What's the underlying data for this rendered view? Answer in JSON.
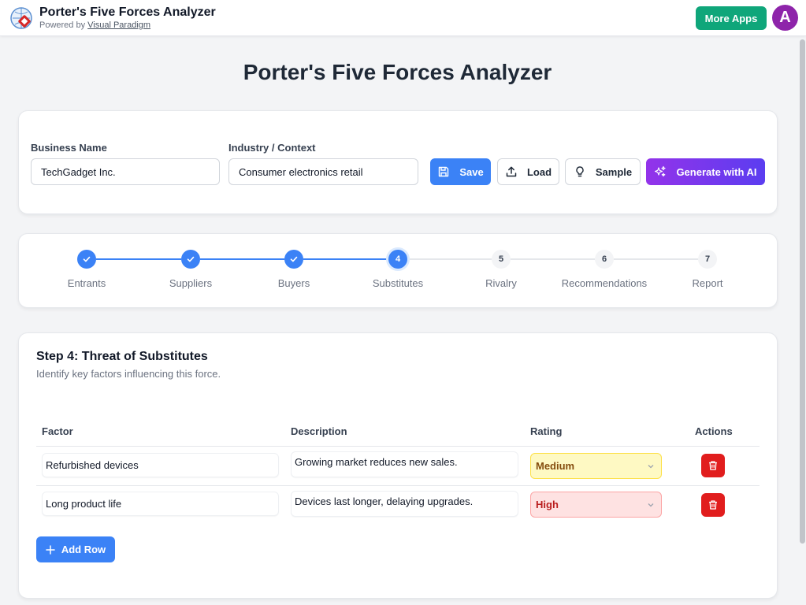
{
  "header": {
    "app_title": "Porter's Five Forces Analyzer",
    "powered_prefix": "Powered by ",
    "powered_link": "Visual Paradigm",
    "more_apps_label": "More Apps",
    "avatar_initial": "A"
  },
  "page": {
    "heading": "Porter's Five Forces Analyzer"
  },
  "business": {
    "name_label": "Business Name",
    "name_value": "TechGadget Inc.",
    "industry_label": "Industry / Context",
    "industry_value": "Consumer electronics retail"
  },
  "toolbar": {
    "save_label": "Save",
    "load_label": "Load",
    "sample_label": "Sample",
    "generate_label": "Generate with AI"
  },
  "steps": [
    {
      "number": "1",
      "label": "Entrants",
      "status": "done"
    },
    {
      "number": "2",
      "label": "Suppliers",
      "status": "done"
    },
    {
      "number": "3",
      "label": "Buyers",
      "status": "done"
    },
    {
      "number": "4",
      "label": "Substitutes",
      "status": "current"
    },
    {
      "number": "5",
      "label": "Rivalry",
      "status": "pending"
    },
    {
      "number": "6",
      "label": "Recommendations",
      "status": "pending"
    },
    {
      "number": "7",
      "label": "Report",
      "status": "pending"
    }
  ],
  "section": {
    "title": "Step 4: Threat of Substitutes",
    "subtitle": "Identify key factors influencing this force."
  },
  "table": {
    "headers": {
      "factor": "Factor",
      "description": "Description",
      "rating": "Rating",
      "actions": "Actions"
    },
    "rows": [
      {
        "factor": "Refurbished devices",
        "description": "Growing market reduces new sales.",
        "rating": "Medium"
      },
      {
        "factor": "Long product life",
        "description": "Devices last longer, delaying upgrades.",
        "rating": "High"
      }
    ]
  },
  "add_row_label": "Add Row",
  "colors": {
    "primary": "#3b82f6",
    "success": "#0fa67a",
    "avatar": "#8e24aa",
    "danger": "#e11d1d",
    "ai_gradient_start": "#9333ea",
    "ai_gradient_end": "#5b3df0"
  }
}
